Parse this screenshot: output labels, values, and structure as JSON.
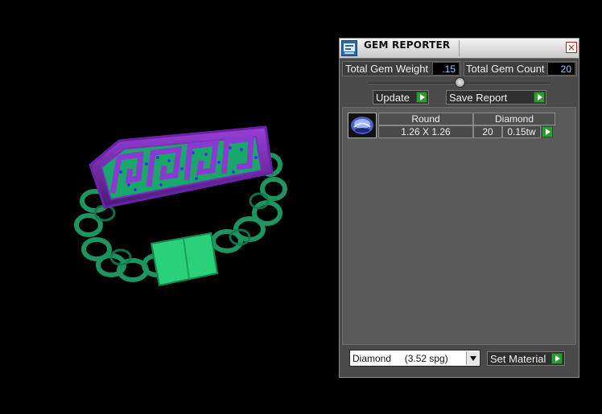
{
  "viewport": {
    "model": "ring-3d-model"
  },
  "panel": {
    "title": "GEM REPORTER",
    "close_glyph": "×",
    "total_weight_label": "Total Gem Weight",
    "total_weight_value": ".15",
    "total_count_label": "Total Gem Count",
    "total_count_value": "20",
    "update_label": "Update",
    "save_report_label": "Save Report",
    "gem_table": {
      "shape": "Round",
      "size": "1.26 X 1.26",
      "material": "Diamond",
      "count": "20",
      "weight": "0.15tw"
    },
    "material_select": "Diamond     (3.52 spg)",
    "set_material_label": "Set Material"
  }
}
